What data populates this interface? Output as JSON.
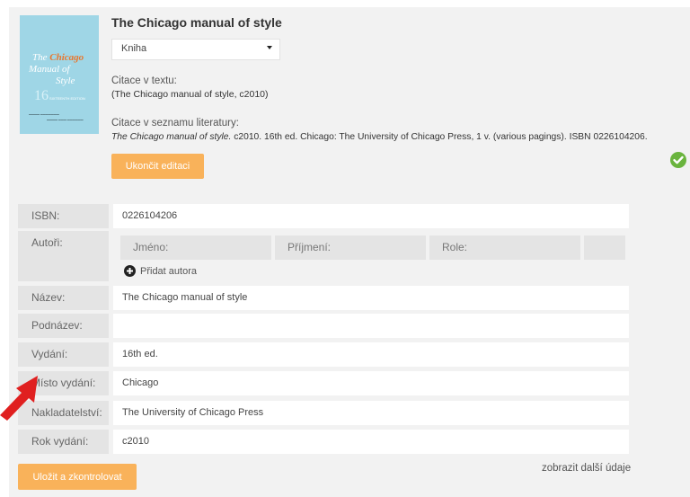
{
  "book": {
    "title": "The Chicago manual of style",
    "type_selected": "Kniha",
    "cover": {
      "line1_a": "The ",
      "line1_b": "Chicago",
      "line2": "Manual of",
      "line3": "Style",
      "edition_numeral": "16",
      "edition_text": "SIXTEENTH EDITION",
      "background": "#9fd6e6"
    }
  },
  "citation": {
    "in_text_label": "Citace v textu:",
    "in_text_value": "(The Chicago manual of style, c2010)",
    "bibliography_label": "Citace v seznamu literatury:",
    "bibliography_italic": "The Chicago manual of style.",
    "bibliography_rest": " c2010. 16th ed. Chicago: The University of Chicago Press, 1 v. (various pagings). ISBN 0226104206."
  },
  "buttons": {
    "finish_edit": "Ukončit editaci",
    "save_check": "Uložit a zkontrolovat",
    "accent": "#f9b25a"
  },
  "status": {
    "icon": "check-circle-icon",
    "color": "#6ab43e"
  },
  "fields": {
    "isbn": {
      "label": "ISBN:",
      "value": "0226104206"
    },
    "authors": {
      "label": "Autoři:",
      "columns": [
        "Jméno:",
        "Příjmení:",
        "Role:"
      ],
      "add_label": "Přidat autora"
    },
    "title": {
      "label": "Název:",
      "value": "The Chicago manual of style"
    },
    "subtitle": {
      "label": "Podnázev:",
      "value": ""
    },
    "edition": {
      "label": "Vydání:",
      "value": "16th ed."
    },
    "place": {
      "label": "Místo vydání:",
      "value": "Chicago"
    },
    "publisher": {
      "label": "Nakladatelství:",
      "value": "The University of Chicago Press"
    },
    "year": {
      "label": "Rok vydání:",
      "value": "c2010"
    }
  },
  "more_link": "zobrazit další údaje",
  "annotation_arrow_color": "#e02020"
}
